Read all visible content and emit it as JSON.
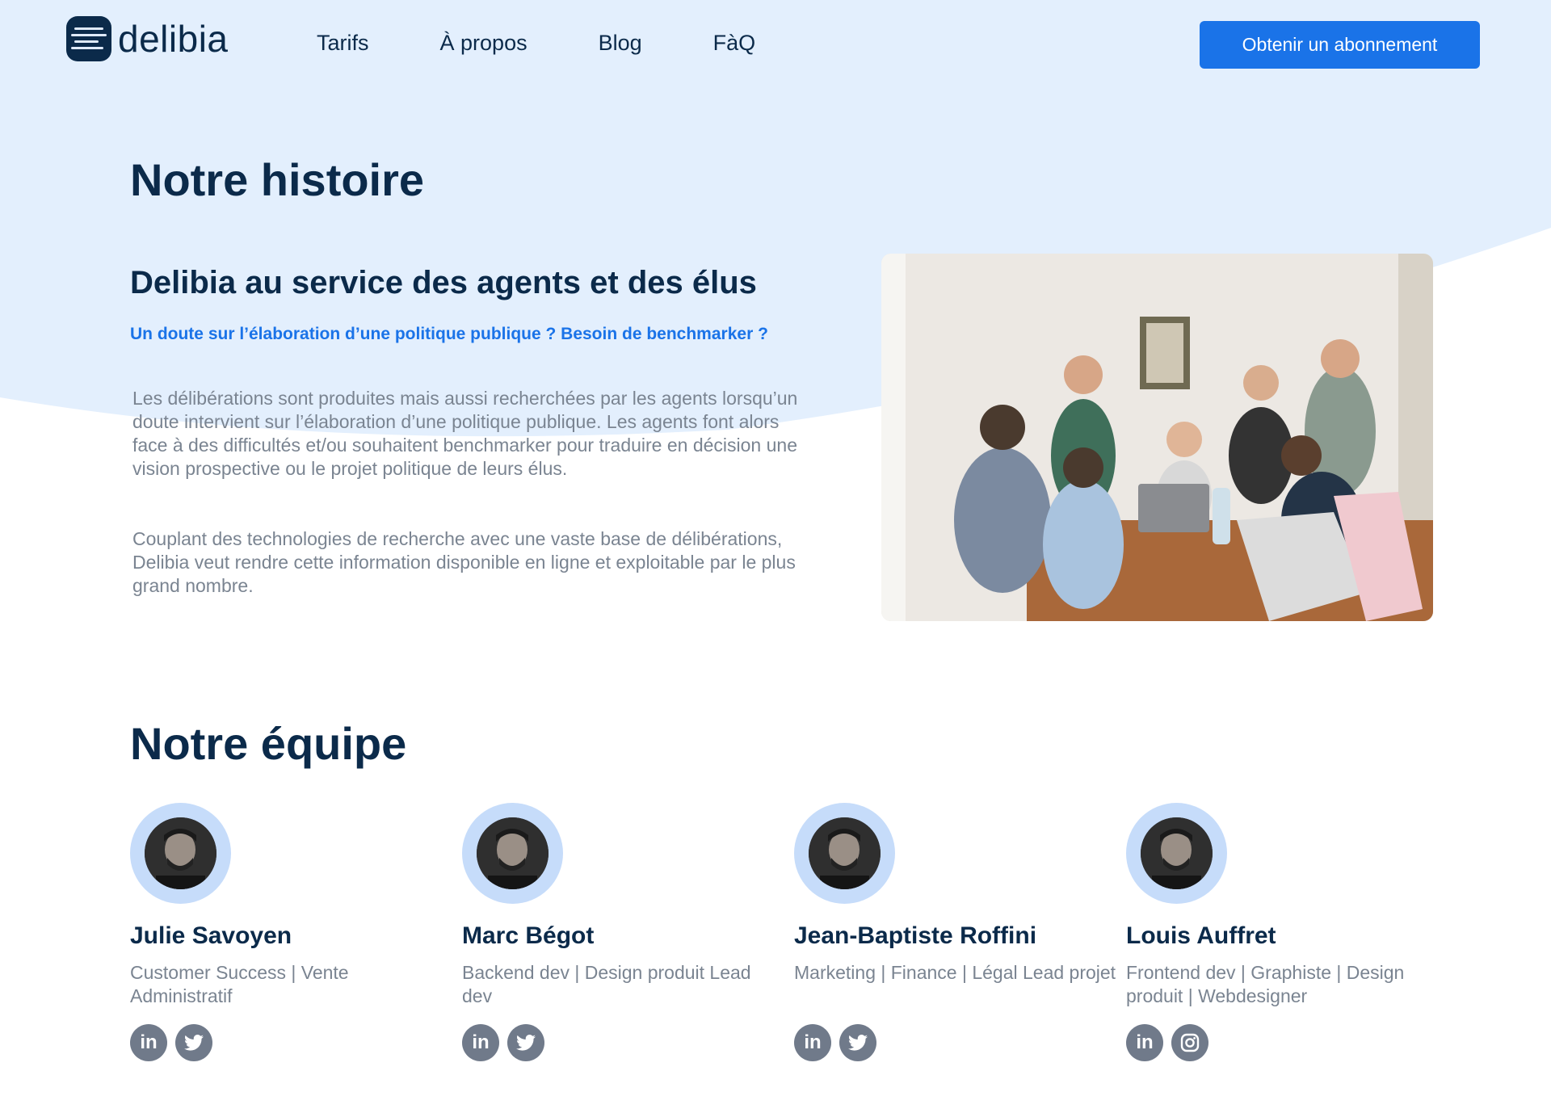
{
  "brand": {
    "name": "delibia"
  },
  "nav": {
    "items": [
      "Tarifs",
      "À propos",
      "Blog",
      "FàQ"
    ]
  },
  "cta": {
    "label": "Obtenir un abonnement"
  },
  "colors": {
    "primary": "#1a73e8",
    "navy": "#0b2a4a",
    "bg_light": "#e3effd",
    "avatar_ring": "#c6dcfa",
    "social": "#707a8a",
    "muted_text": "#7a8491"
  },
  "history": {
    "title": "Notre histoire",
    "subtitle": "Delibia au service des agents et des élus",
    "lead": "Un doute sur l’élaboration d’une politique publique ? Besoin de benchmarker ?",
    "paragraphs": [
      "Les délibérations sont produites mais aussi recherchées par les agents lorsqu’un doute intervient sur l’élaboration d’une politique publique. Les agents font alors face à des difficultés et/ou souhaitent benchmarker pour traduire en décision une vision prospective ou le projet politique de leurs élus.",
      "Couplant des technologies de recherche avec une vaste base de délibérations, Delibia veut rendre cette information disponible en ligne et exploitable par le plus grand nombre."
    ]
  },
  "team": {
    "title": "Notre équipe",
    "members": [
      {
        "name": "Julie Savoyen",
        "role": "Customer Success | Vente Administratif",
        "socials": [
          "linkedin-icon",
          "twitter-icon"
        ]
      },
      {
        "name": "Marc Bégot",
        "role": "Backend dev | Design produit Lead dev",
        "socials": [
          "linkedin-icon",
          "twitter-icon"
        ]
      },
      {
        "name": "Jean-Baptiste Roffini",
        "role": "Marketing | Finance | Légal Lead projet",
        "socials": [
          "linkedin-icon",
          "twitter-icon"
        ]
      },
      {
        "name": "Louis Auffret",
        "role": "Frontend dev | Graphiste | Design produit | Webdesigner",
        "socials": [
          "linkedin-icon",
          "instagram-icon"
        ]
      }
    ]
  }
}
